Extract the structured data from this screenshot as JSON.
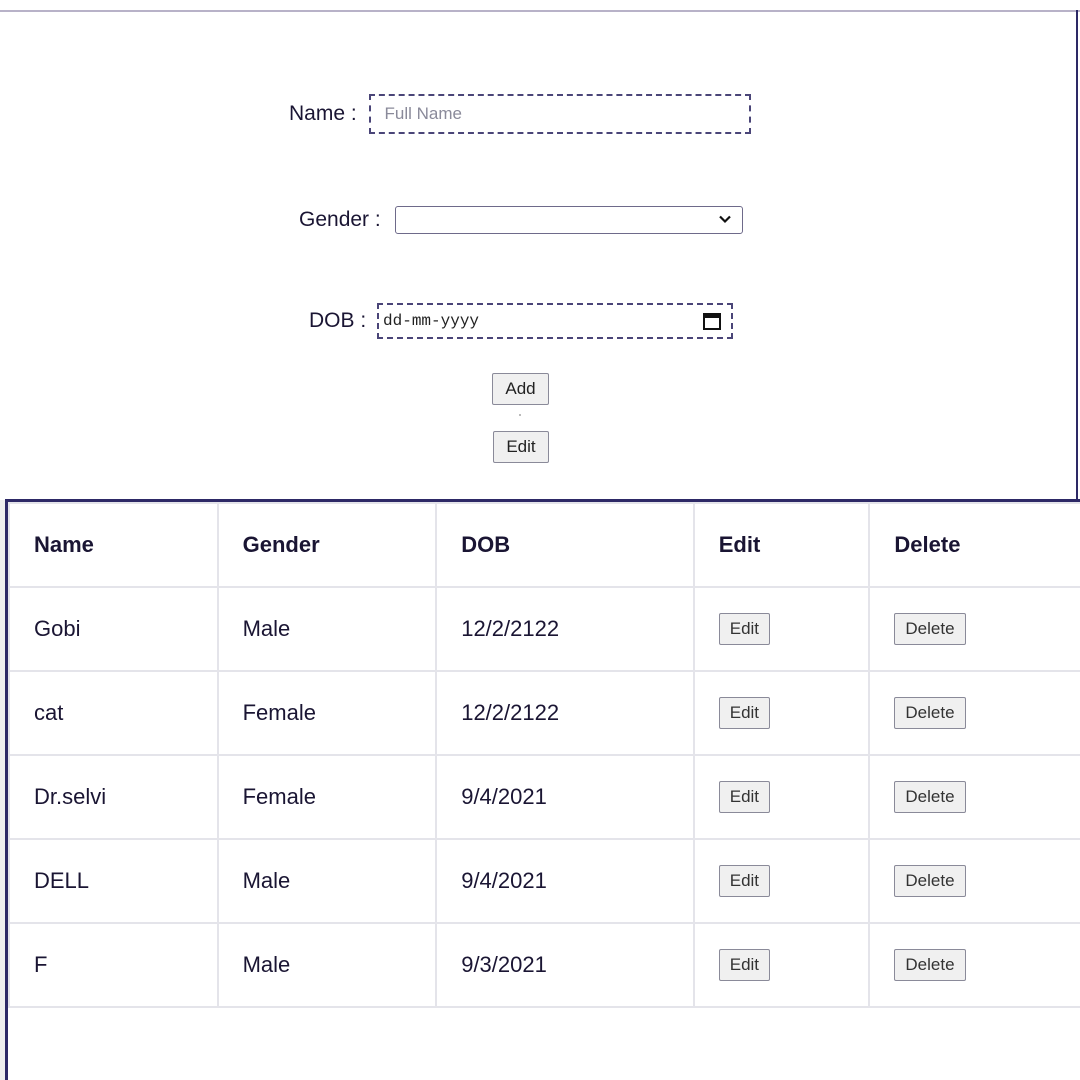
{
  "form": {
    "name_label": "Name : ",
    "name_placeholder": "Full Name",
    "gender_label": "Gender : ",
    "gender_value": "",
    "dob_label": "DOB : ",
    "dob_placeholder": "dd-mm-yyyy",
    "add_label": "Add",
    "edit_label": "Edit"
  },
  "table": {
    "headers": [
      "Name",
      "Gender",
      "DOB",
      "Edit",
      "Delete"
    ],
    "rows": [
      {
        "name": "Gobi",
        "gender": "Male",
        "dob": "12/2/2122",
        "edit": "Edit",
        "delete": "Delete"
      },
      {
        "name": "cat",
        "gender": "Female",
        "dob": "12/2/2122",
        "edit": "Edit",
        "delete": "Delete"
      },
      {
        "name": "Dr.selvi",
        "gender": "Female",
        "dob": "9/4/2021",
        "edit": "Edit",
        "delete": "Delete"
      },
      {
        "name": "DELL",
        "gender": "Male",
        "dob": "9/4/2021",
        "edit": "Edit",
        "delete": "Delete"
      },
      {
        "name": "F",
        "gender": "Male",
        "dob": "9/3/2021",
        "edit": "Edit",
        "delete": "Delete"
      }
    ]
  },
  "icons": {
    "gender_dropdown": "chevron-down-icon",
    "dob_picker": "calendar-icon"
  },
  "colors": {
    "text": "#1a1533",
    "accent_border": "#2d2966",
    "dashed_border": "#4a4578"
  }
}
